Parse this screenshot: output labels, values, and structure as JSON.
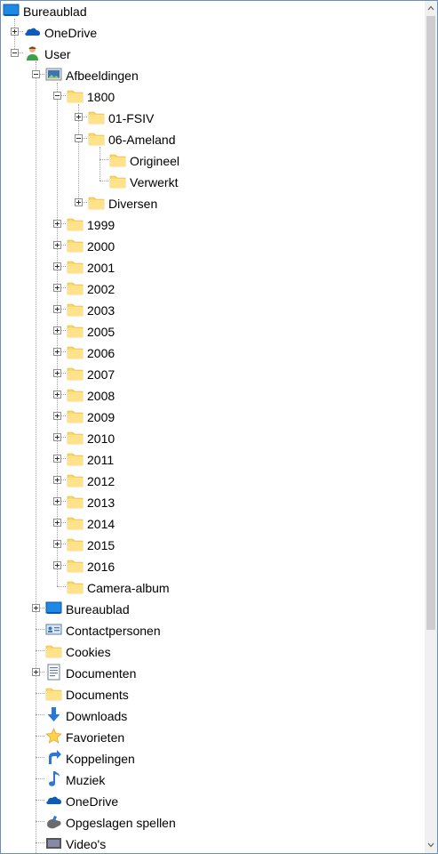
{
  "tree": {
    "rows": [
      {
        "label": "Bureaublad",
        "icon": "desktop-icon",
        "level": 0,
        "expander": "none"
      },
      {
        "label": "OneDrive",
        "icon": "onedrive-cloud-icon",
        "level": 1,
        "expander": "plus"
      },
      {
        "label": "User",
        "icon": "user-icon",
        "level": 1,
        "expander": "minus"
      },
      {
        "label": "Afbeeldingen",
        "icon": "pictures-library-icon",
        "level": 2,
        "expander": "minus"
      },
      {
        "label": "1800",
        "icon": "folder-icon",
        "level": 3,
        "expander": "minus"
      },
      {
        "label": "01-FSIV",
        "icon": "folder-icon",
        "level": 4,
        "expander": "plus"
      },
      {
        "label": "06-Ameland",
        "icon": "folder-icon",
        "level": 4,
        "expander": "minus"
      },
      {
        "label": "Origineel",
        "icon": "folder-icon",
        "level": 5,
        "expander": "none"
      },
      {
        "label": "Verwerkt",
        "icon": "folder-icon",
        "level": 5,
        "expander": "none"
      },
      {
        "label": "Diversen",
        "icon": "folder-icon",
        "level": 4,
        "expander": "plus"
      },
      {
        "label": "1999",
        "icon": "folder-icon",
        "level": 3,
        "expander": "plus"
      },
      {
        "label": "2000",
        "icon": "folder-icon",
        "level": 3,
        "expander": "plus"
      },
      {
        "label": "2001",
        "icon": "folder-icon",
        "level": 3,
        "expander": "plus"
      },
      {
        "label": "2002",
        "icon": "folder-icon",
        "level": 3,
        "expander": "plus"
      },
      {
        "label": "2003",
        "icon": "folder-icon",
        "level": 3,
        "expander": "plus"
      },
      {
        "label": "2005",
        "icon": "folder-icon",
        "level": 3,
        "expander": "plus"
      },
      {
        "label": "2006",
        "icon": "folder-icon",
        "level": 3,
        "expander": "plus"
      },
      {
        "label": "2007",
        "icon": "folder-icon",
        "level": 3,
        "expander": "plus"
      },
      {
        "label": "2008",
        "icon": "folder-icon",
        "level": 3,
        "expander": "plus"
      },
      {
        "label": "2009",
        "icon": "folder-icon",
        "level": 3,
        "expander": "plus"
      },
      {
        "label": "2010",
        "icon": "folder-icon",
        "level": 3,
        "expander": "plus"
      },
      {
        "label": "2011",
        "icon": "folder-icon",
        "level": 3,
        "expander": "plus"
      },
      {
        "label": "2012",
        "icon": "folder-icon",
        "level": 3,
        "expander": "plus"
      },
      {
        "label": "2013",
        "icon": "folder-icon",
        "level": 3,
        "expander": "plus"
      },
      {
        "label": "2014",
        "icon": "folder-icon",
        "level": 3,
        "expander": "plus"
      },
      {
        "label": "2015",
        "icon": "folder-icon",
        "level": 3,
        "expander": "plus"
      },
      {
        "label": "2016",
        "icon": "folder-icon",
        "level": 3,
        "expander": "plus"
      },
      {
        "label": "Camera-album",
        "icon": "folder-icon",
        "level": 3,
        "expander": "none"
      },
      {
        "label": "Bureaublad",
        "icon": "desktop-icon",
        "level": 2,
        "expander": "plus"
      },
      {
        "label": "Contactpersonen",
        "icon": "contacts-icon",
        "level": 2,
        "expander": "none"
      },
      {
        "label": "Cookies",
        "icon": "folder-icon",
        "level": 2,
        "expander": "none"
      },
      {
        "label": "Documenten",
        "icon": "documents-icon",
        "level": 2,
        "expander": "plus"
      },
      {
        "label": "Documents",
        "icon": "folder-icon",
        "level": 2,
        "expander": "none"
      },
      {
        "label": "Downloads",
        "icon": "downloads-arrow-icon",
        "level": 2,
        "expander": "none"
      },
      {
        "label": "Favorieten",
        "icon": "favorites-star-icon",
        "level": 2,
        "expander": "none"
      },
      {
        "label": "Koppelingen",
        "icon": "links-arrow-icon",
        "level": 2,
        "expander": "none"
      },
      {
        "label": "Muziek",
        "icon": "music-note-icon",
        "level": 2,
        "expander": "none"
      },
      {
        "label": "OneDrive",
        "icon": "onedrive-cloud-icon",
        "level": 2,
        "expander": "none"
      },
      {
        "label": "Opgeslagen spellen",
        "icon": "saved-games-icon",
        "level": 2,
        "expander": "none"
      },
      {
        "label": "Video's",
        "icon": "videos-icon",
        "level": 2,
        "expander": "none"
      }
    ]
  },
  "colors": {
    "folder": "#ffd75e",
    "desktop": "#1e88e5",
    "onedrive": "#0f5cb8",
    "tree_lines": "#a0a0a0",
    "scrollbar_track": "#f0f0f0",
    "scrollbar_thumb": "#cdcdcd"
  },
  "scrollbar": {
    "up_icon": "chevron-up-icon",
    "down_icon": "chevron-down-icon"
  }
}
